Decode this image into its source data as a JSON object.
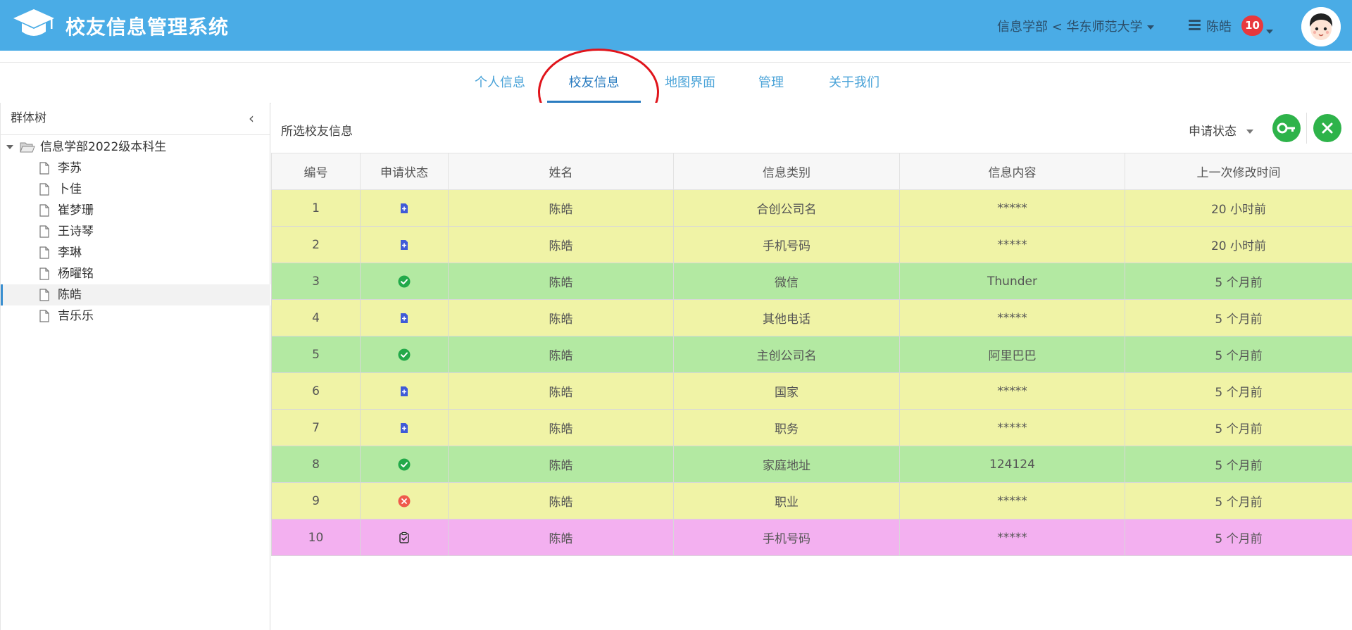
{
  "header": {
    "app_title": "校友信息管理系统",
    "org_dropdown": "信息学部 < 华东师范大学",
    "user_name": "陈皓",
    "notification_count": "10",
    "accent_color": "#4aace6"
  },
  "nav": {
    "tabs": [
      {
        "label": "个人信息",
        "active": false
      },
      {
        "label": "校友信息",
        "active": true
      },
      {
        "label": "地图界面",
        "active": false
      },
      {
        "label": "管理",
        "active": false
      },
      {
        "label": "关于我们",
        "active": false
      }
    ]
  },
  "sidebar": {
    "title": "群体树",
    "root": "信息学部2022级本科生",
    "items": [
      {
        "label": "李苏"
      },
      {
        "label": "卜佳"
      },
      {
        "label": "崔梦珊"
      },
      {
        "label": "王诗琴"
      },
      {
        "label": "李琳"
      },
      {
        "label": "杨曜铭"
      },
      {
        "label": "陈皓",
        "selected": true
      },
      {
        "label": "吉乐乐"
      }
    ]
  },
  "main": {
    "title": "所选校友信息",
    "status_filter": "申请状态",
    "columns": [
      "编号",
      "申请状态",
      "姓名",
      "信息类别",
      "信息内容",
      "上一次修改时间"
    ],
    "rows": [
      {
        "id": "1",
        "status": "pending",
        "name": "陈皓",
        "category": "合创公司名",
        "content": "*****",
        "modified": "20 小时前"
      },
      {
        "id": "2",
        "status": "pending",
        "name": "陈皓",
        "category": "手机号码",
        "content": "*****",
        "modified": "20 小时前"
      },
      {
        "id": "3",
        "status": "approved",
        "name": "陈皓",
        "category": "微信",
        "content": "Thunder",
        "modified": "5 个月前"
      },
      {
        "id": "4",
        "status": "pending",
        "name": "陈皓",
        "category": "其他电话",
        "content": "*****",
        "modified": "5 个月前"
      },
      {
        "id": "5",
        "status": "approved",
        "name": "陈皓",
        "category": "主创公司名",
        "content": "阿里巴巴",
        "modified": "5 个月前"
      },
      {
        "id": "6",
        "status": "pending",
        "name": "陈皓",
        "category": "国家",
        "content": "*****",
        "modified": "5 个月前"
      },
      {
        "id": "7",
        "status": "pending",
        "name": "陈皓",
        "category": "职务",
        "content": "*****",
        "modified": "5 个月前"
      },
      {
        "id": "8",
        "status": "approved",
        "name": "陈皓",
        "category": "家庭地址",
        "content": "124124",
        "modified": "5 个月前"
      },
      {
        "id": "9",
        "status": "rejected",
        "name": "陈皓",
        "category": "职业",
        "content": "*****",
        "modified": "5 个月前"
      },
      {
        "id": "10",
        "status": "review",
        "name": "陈皓",
        "category": "手机号码",
        "content": "*****",
        "modified": "5 个月前"
      }
    ]
  },
  "colors": {
    "pending_row": "#f0f3a6",
    "approved_row": "#b3e9a2",
    "review_row": "#f3b0f0",
    "annotation": "#e0141b"
  }
}
